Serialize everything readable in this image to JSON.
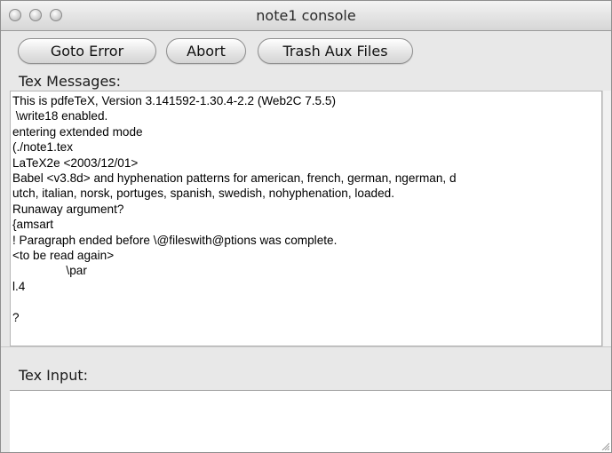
{
  "window": {
    "title": "note1 console"
  },
  "toolbar": {
    "goto_error_label": "Goto Error",
    "abort_label": "Abort",
    "trash_aux_label": "Trash Aux Files"
  },
  "messages": {
    "label": "Tex Messages:",
    "text": "This is pdfeTeX, Version 3.141592-1.30.4-2.2 (Web2C 7.5.5)\n \\write18 enabled.\nentering extended mode\n(./note1.tex\nLaTeX2e <2003/12/01>\nBabel <v3.8d> and hyphenation patterns for american, french, german, ngerman, d\nutch, italian, norsk, portuges, spanish, swedish, nohyphenation, loaded.\nRunaway argument?\n{amsart\n! Paragraph ended before \\@fileswith@ptions was complete.\n<to be read again>\n                \\par\nl.4\n\n?"
  },
  "input": {
    "label": "Tex Input:",
    "value": ""
  }
}
